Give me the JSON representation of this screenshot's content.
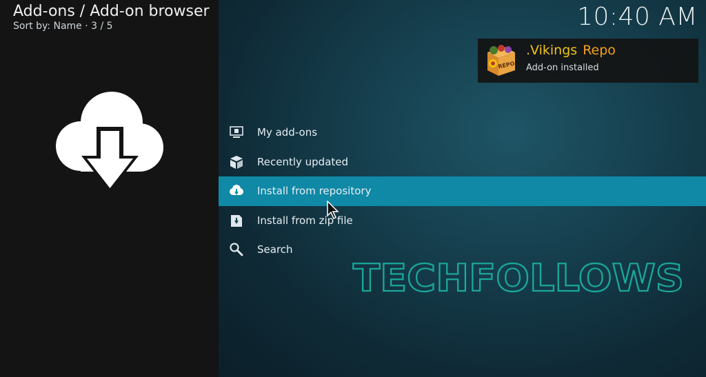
{
  "header": {
    "title": "Add-ons / Add-on browser",
    "subtitle": "Sort by: Name  ·  3 / 5"
  },
  "clock": "10:40 AM",
  "big_icon": "cloud-download-icon",
  "notification": {
    "title_part1": ".Vikings",
    "title_part2": "Repo",
    "message": "Add-on installed",
    "thumbnail": "repo-box-icon",
    "title_color": "#f0c419",
    "accent_color": "#f5a020"
  },
  "menu": {
    "selected_index": 2,
    "highlight_color": "#0f89a6",
    "items": [
      {
        "label": "My add-ons",
        "icon": "monitor-addon-icon"
      },
      {
        "label": "Recently updated",
        "icon": "open-box-icon"
      },
      {
        "label": "Install from repository",
        "icon": "cloud-download-icon"
      },
      {
        "label": "Install from zip file",
        "icon": "zip-file-icon"
      },
      {
        "label": "Search",
        "icon": "search-icon"
      }
    ]
  },
  "watermark": {
    "text": "TECHFOLLOWS",
    "color": "#1aa89a"
  }
}
